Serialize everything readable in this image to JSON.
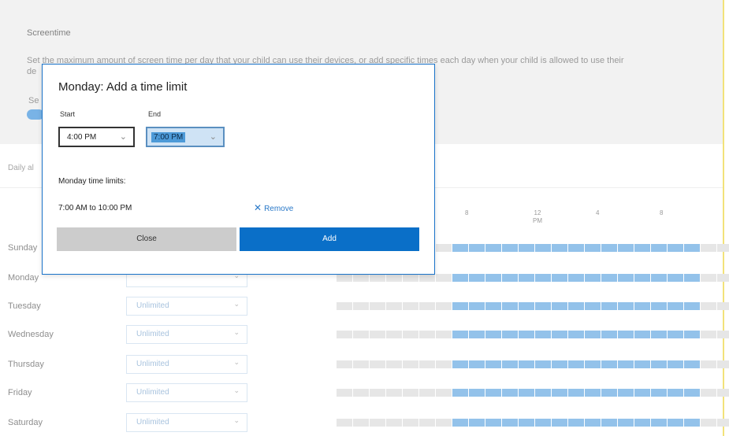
{
  "screentime": {
    "title": "Screentime",
    "description": "Set the maximum amount of screen time per day that your child can use their devices, or add specific times each day when your child is allowed to use their",
    "description_cont": "de",
    "set_label": "Se",
    "toggle_on": true
  },
  "daily_label": "Daily al",
  "timeline_ticks": [
    "8",
    "12\nPM",
    "4",
    "8"
  ],
  "days": [
    {
      "name": "Sunday",
      "limit": ""
    },
    {
      "name": "Monday",
      "limit": ""
    },
    {
      "name": "Tuesday",
      "limit": "Unlimited"
    },
    {
      "name": "Wednesday",
      "limit": "Unlimited"
    },
    {
      "name": "Thursday",
      "limit": "Unlimited"
    },
    {
      "name": "Friday",
      "limit": "Unlimited"
    },
    {
      "name": "Saturday",
      "limit": "Unlimited"
    }
  ],
  "colors": {
    "allowed": "#93c2ea",
    "blocked": "#e6e6e6",
    "accent": "#0a6fc8"
  },
  "dialog": {
    "title": "Monday: Add a time limit",
    "start_label": "Start",
    "start_value": "4:00 PM",
    "end_label": "End",
    "end_value": "7:00 PM",
    "limits_label": "Monday time limits:",
    "limits_value": "7:00 AM to 10:00 PM",
    "remove_label": "Remove",
    "close_label": "Close",
    "add_label": "Add"
  }
}
